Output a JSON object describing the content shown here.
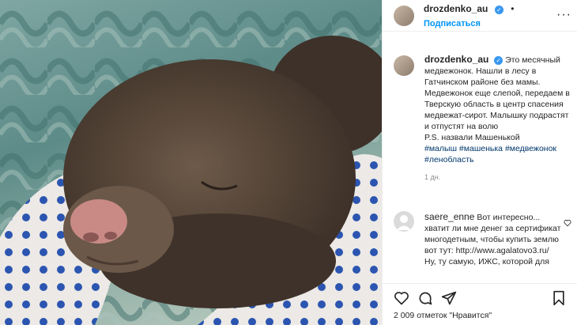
{
  "header": {
    "username": "drozdenko_au",
    "follow_label": "Подписаться",
    "separator": "•",
    "more_label": "···"
  },
  "caption": {
    "username": "drozdenko_au",
    "text": "Это месячный медвежонок. Нашли в лесу в Гатчинском районе без мамы. Медвежонок еще слепой, передаем в Тверскую область в центр спасения медвежат-сирот. Малышку подрастят и отпустят на волю",
    "ps": "P.S. назвали Машенькой",
    "hashtags": [
      "#малыш",
      "#машенька",
      "#медвежонок",
      "#ленобласть"
    ],
    "time": "1 дн."
  },
  "comment": {
    "username": "saere_enne",
    "text": "Вот интересно... хватит ли мне денег за сертификат многодетным, чтобы купить землю вот тут: http://www.agalatovo3.ru/ Ну, ту самую, ИЖС, которой для"
  },
  "likes": {
    "text": "2 009 отметок \"Нравится\""
  },
  "icons": [
    "heart-icon",
    "comment-icon",
    "share-icon",
    "bookmark-icon",
    "verified-icon",
    "more-icon"
  ],
  "colors": {
    "accent": "#0095f6",
    "verified": "#3897f0",
    "text": "#262626",
    "muted": "#8e8e8e",
    "hashtag": "#00376b"
  }
}
